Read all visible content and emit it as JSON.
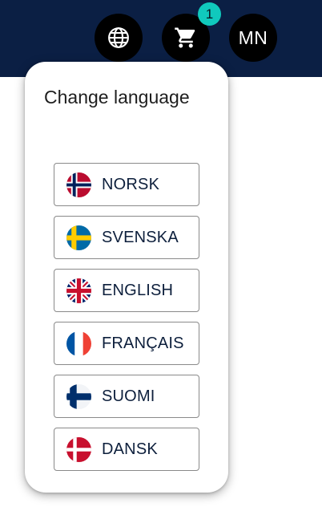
{
  "header": {
    "cart_count": "1",
    "user_initials": "MN"
  },
  "language_menu": {
    "title": "Change language",
    "languages": [
      {
        "label": "NORSK",
        "flag": "norway-flag-icon"
      },
      {
        "label": "SVENSKA",
        "flag": "sweden-flag-icon"
      },
      {
        "label": "ENGLISH",
        "flag": "uk-flag-icon"
      },
      {
        "label": "FRANÇAIS",
        "flag": "france-flag-icon"
      },
      {
        "label": "SUOMI",
        "flag": "finland-flag-icon"
      },
      {
        "label": "DANSK",
        "flag": "denmark-flag-icon"
      }
    ]
  },
  "colors": {
    "header_bg": "#0b1f44",
    "badge": "#10c9bd",
    "label_text": "#0d1f3c"
  }
}
